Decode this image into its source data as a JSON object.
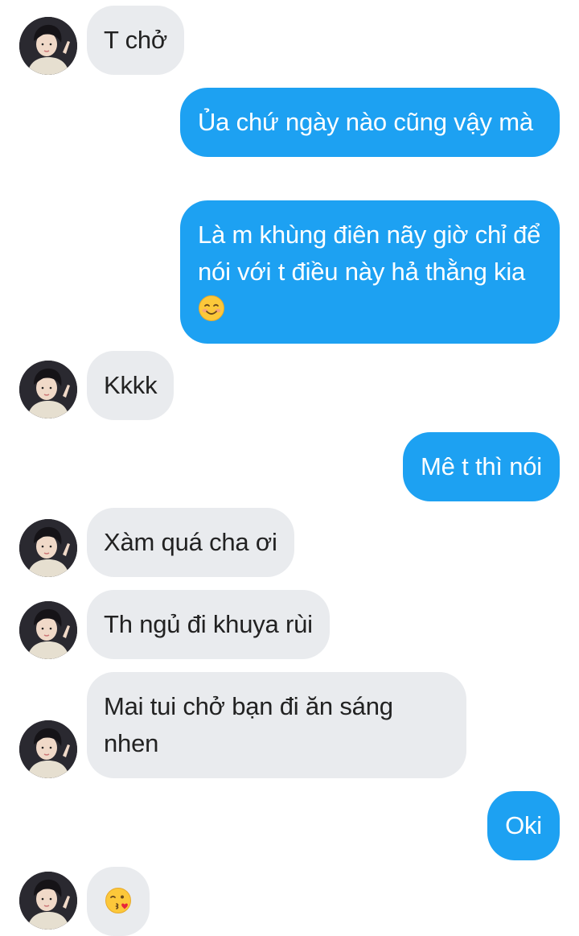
{
  "chat": {
    "messages": [
      {
        "from": "them",
        "text": "T chở"
      },
      {
        "from": "me",
        "text": "Ủa chứ ngày nào cũng vậy mà"
      },
      {
        "from": "me",
        "text": "Là m khùng điên nãy giờ chỉ để nói với t điều này hả thằng kia",
        "emoji": "smiling-face-icon"
      },
      {
        "from": "them",
        "text": "Kkkk"
      },
      {
        "from": "me",
        "text": "Mê t thì nói"
      },
      {
        "from": "them",
        "text": "Xàm quá cha ơi"
      },
      {
        "from": "them",
        "text": "Th ngủ đi khuya rùi"
      },
      {
        "from": "them",
        "text": "Mai tui chở bạn đi ăn sáng nhen"
      },
      {
        "from": "me",
        "text": "Oki"
      },
      {
        "from": "them",
        "text": "",
        "emoji": "face-blowing-kiss-icon"
      }
    ]
  },
  "colors": {
    "incoming_bubble": "#e9ebee",
    "outgoing_bubble": "#1da1f2",
    "incoming_text": "#222222",
    "outgoing_text": "#ffffff"
  }
}
